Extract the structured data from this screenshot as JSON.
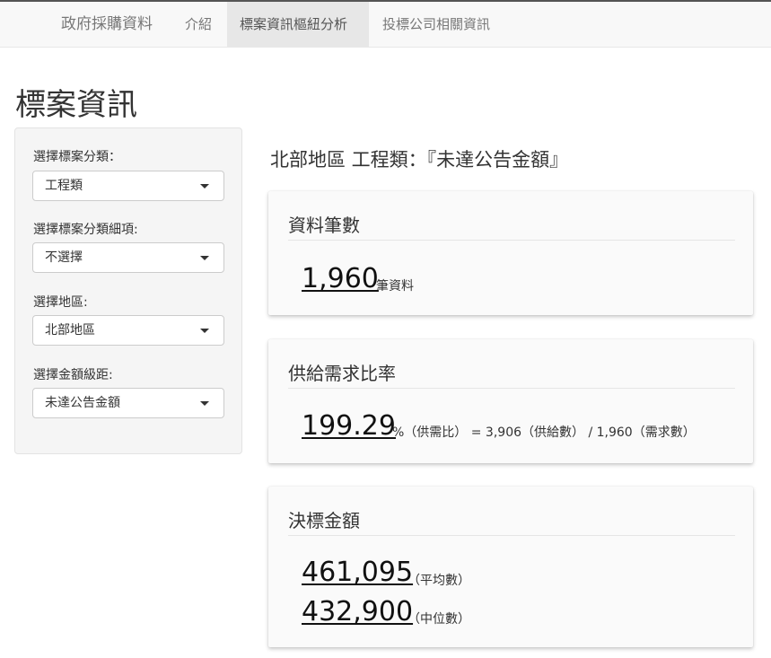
{
  "navbar": {
    "brand": "政府採購資料",
    "items": [
      {
        "label": "介紹",
        "active": false
      },
      {
        "label": "標案資訊樞紐分析",
        "active": true
      },
      {
        "label": "投標公司相關資訊",
        "active": false
      }
    ]
  },
  "page_title": "標案資訊",
  "sidebar": {
    "fields": [
      {
        "label": "選擇標案分類：",
        "value": "工程類"
      },
      {
        "label": "選擇標案分類細項:",
        "value": "不選擇"
      },
      {
        "label": "選擇地區:",
        "value": "北部地區"
      },
      {
        "label": "選擇金額級距:",
        "value": "未達公告金額"
      }
    ]
  },
  "main": {
    "heading": "北部地區 工程類：『未達公告金額』",
    "cards": {
      "count": {
        "title": "資料筆數",
        "value": "1,960",
        "unit": "筆資料"
      },
      "ratio": {
        "title": "供給需求比率",
        "value": "199.29",
        "detail": "%（供需比） = 3,906（供給數） / 1,960（需求數）"
      },
      "amount": {
        "title": "決標金額",
        "mean_value": "461,095",
        "mean_label": "（平均數）",
        "median_value": "432,900",
        "median_label": "（中位數）"
      }
    }
  },
  "colors": {
    "navbar_bg": "#f8f8f8",
    "active_tab_bg": "#e7e7e7",
    "sidebar_bg": "#f5f5f5",
    "card_bg": "#fafafa"
  }
}
